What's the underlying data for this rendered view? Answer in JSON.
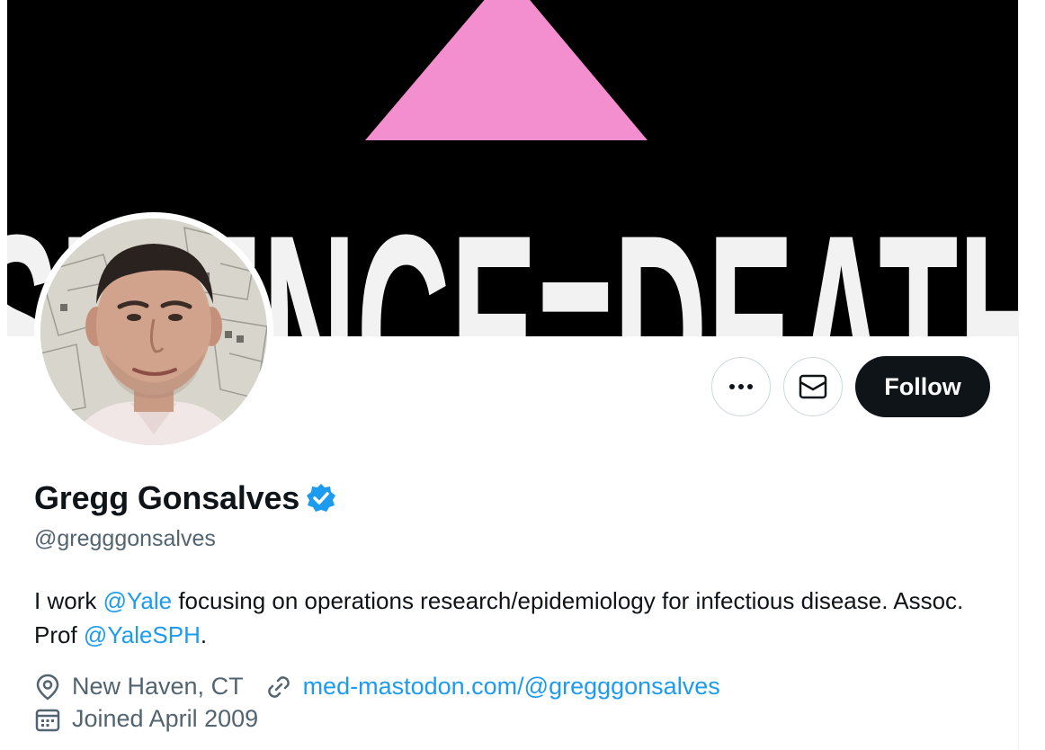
{
  "banner": {
    "text": "SILENCE=DEATH",
    "triangle_color": "#f48fcf",
    "background": "#000000"
  },
  "profile": {
    "display_name": "Gregg Gonsalves",
    "verified_icon": "verified-badge-icon",
    "handle": "@gregggonsalves",
    "bio": {
      "part1": "I work ",
      "mention1": "@Yale",
      "part2": " focusing on operations research/epidemiology for infectious disease. Assoc. Prof ",
      "mention2": "@YaleSPH",
      "part3": "."
    },
    "location": "New Haven, CT",
    "website": "med-mastodon.com/@gregggonsalves",
    "joined": "Joined April 2009"
  },
  "actions": {
    "more_icon": "more-icon",
    "message_icon": "envelope-icon",
    "follow_label": "Follow"
  },
  "colors": {
    "accent": "#1d9bf0",
    "text": "#0f1419",
    "secondary": "#536471",
    "follow_bg": "#0f1419"
  }
}
